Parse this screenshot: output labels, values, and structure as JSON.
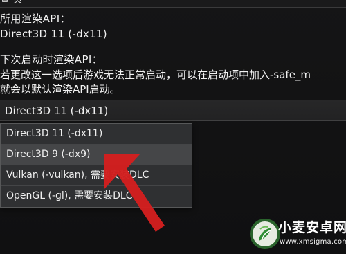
{
  "top": {
    "partial_title": "宣 贝"
  },
  "settings": {
    "current_label": "所用渲染API：",
    "current_value": "Direct3D 11 (-dx11)",
    "next_label": "下次启动时渲染API：",
    "warning_line1": "若更改这一选项后游戏无法正常启动，可以在启动项中加入-safe_m",
    "warning_line2": "就会以默认渲染API启动。",
    "selected_value": "Direct3D 11 (-dx11)"
  },
  "dropdown": {
    "options": [
      "Direct3D 11 (-dx11)",
      "Direct3D 9 (-dx9)",
      "Vulkan (-vulkan), 需要安装DLC",
      "OpenGL (-gl), 需要安装DLC"
    ],
    "highlighted_index": 1
  },
  "watermark": {
    "title": "小麦安卓网",
    "url": "www.xmsigma.com"
  },
  "colors": {
    "arrow": "#d31f1f",
    "highlight": "#454648",
    "dropdown_bg": "#2f3032"
  },
  "icons": {
    "arrow": "red-arrow-icon",
    "logo": "leaf-logo-icon"
  }
}
